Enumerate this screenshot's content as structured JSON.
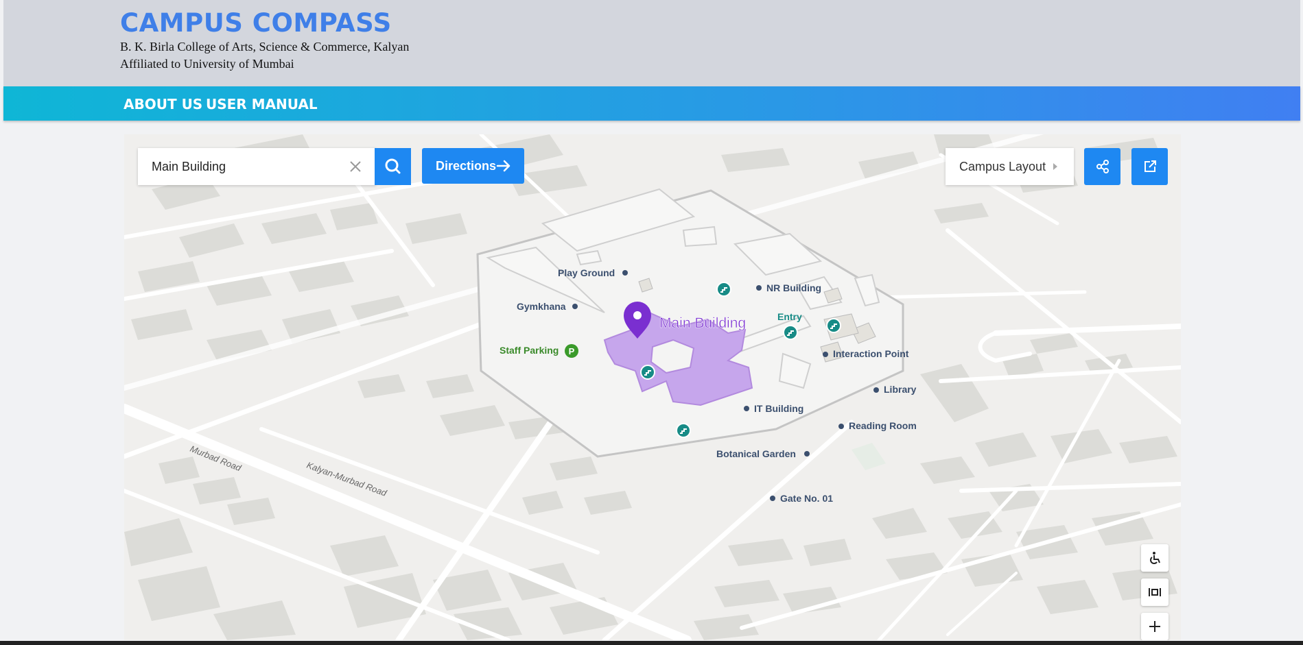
{
  "header": {
    "title": "CAMPUS COMPASS",
    "subtitle_line1": "B. K. Birla College of Arts, Science & Commerce, Kalyan",
    "subtitle_line2": "Affiliated to University of Mumbai"
  },
  "nav": {
    "items": [
      {
        "label": "ABOUT US"
      },
      {
        "label": "USER MANUAL"
      }
    ]
  },
  "toolbar": {
    "search_value": "Main Building",
    "directions_label": "Directions",
    "layout_label": "Campus Layout"
  },
  "map": {
    "selected": "Main Building",
    "places": {
      "play_ground": "Play Ground",
      "gymkhana": "Gymkhana",
      "staff_parking": "Staff Parking",
      "nr_building": "NR Building",
      "entry": "Entry",
      "interaction_point": "Interaction Point",
      "library": "Library",
      "it_building": "IT Building",
      "reading_room": "Reading Room",
      "botanical_garden": "Botanical Garden",
      "gate_no_01": "Gate No. 01"
    },
    "roads": {
      "murbad_road": "Murbad Road",
      "kalyan_murbad_road": "Kalyan-Murbad Road"
    },
    "parking_glyph": "P"
  },
  "colors": {
    "accent": "#1e88f2",
    "brand": "#3f7fe8",
    "selected_building": "#c6a6ec",
    "marker": "#7a2fd0",
    "entry_icon": "#178b86",
    "parking": "#3a9a2a"
  },
  "icons": {
    "search": "search-icon",
    "clear": "close-icon",
    "arrow": "arrow-right-icon",
    "share": "share-icon",
    "open": "external-link-icon",
    "accessibility": "wheelchair-icon",
    "fit": "fit-bounds-icon",
    "zoom_in": "plus-icon"
  }
}
